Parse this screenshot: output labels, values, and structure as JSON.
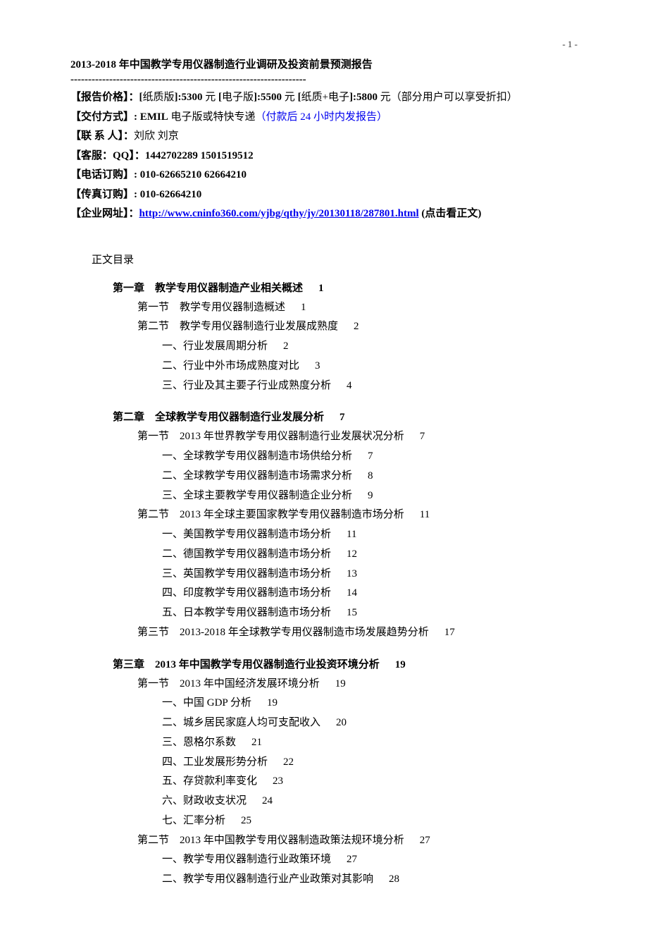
{
  "pageNumber": "- 1 -",
  "title": "2013-2018 年中国教学专用仪器制造行业调研及投资前景预测报告",
  "separator": "-------------------------------------------------------------------",
  "info": {
    "price_label": "【报告价格】：[",
    "price_paper_label": "纸质版",
    "price_paper": "]:5300",
    "price_yuan": " 元 ",
    "price_e_label_open": "[",
    "price_e_label": "电子版",
    "price_e": "]:5500",
    "price_pe_open": "[",
    "price_pe_label": "纸质+电子",
    "price_pe": "]:5800",
    "price_suffix": " 元（部分用户可以享受折扣）",
    "delivery_label": "【交付方式】: EMIL",
    "delivery_text": " 电子版或特快专递",
    "delivery_blue": "（付款后 24 小时内发报告）",
    "contact_label": "【联 系 人】：",
    "contact_names": "刘欣 刘京",
    "qq_label": "【客服：QQ】：1442702289 1501519512",
    "phone_label": "【电话订购】: 010-62665210 62664210",
    "fax_label": "【传真订购】: 010-62664210",
    "url_label": "【企业网址】：",
    "url": "http://www.cninfo360.com/yjbg/qthy/jy/20130118/287801.html",
    "url_suffix": " (点击看正文)"
  },
  "tocHeader": "正文目录",
  "toc": [
    {
      "type": "chapter",
      "text": "第一章　教学专用仪器制造产业相关概述",
      "page": "1"
    },
    {
      "type": "section",
      "text": "第一节　教学专用仪器制造概述",
      "page": "1"
    },
    {
      "type": "section",
      "text": "第二节　教学专用仪器制造行业发展成熟度",
      "page": "2"
    },
    {
      "type": "item",
      "text": "一、行业发展周期分析",
      "page": "2"
    },
    {
      "type": "item",
      "text": "二、行业中外市场成熟度对比",
      "page": "3"
    },
    {
      "type": "item",
      "text": "三、行业及其主要子行业成熟度分析",
      "page": "4"
    },
    {
      "type": "chapter",
      "text": "第二章　全球教学专用仪器制造行业发展分析",
      "page": "7"
    },
    {
      "type": "section",
      "text": "第一节　2013 年世界教学专用仪器制造行业发展状况分析",
      "page": "7"
    },
    {
      "type": "item",
      "text": "一、全球教学专用仪器制造市场供给分析",
      "page": "7"
    },
    {
      "type": "item",
      "text": "二、全球教学专用仪器制造市场需求分析",
      "page": "8"
    },
    {
      "type": "item",
      "text": "三、全球主要教学专用仪器制造企业分析",
      "page": "9"
    },
    {
      "type": "section",
      "text": "第二节　2013 年全球主要国家教学专用仪器制造市场分析",
      "page": "11"
    },
    {
      "type": "item",
      "text": "一、美国教学专用仪器制造市场分析",
      "page": "11"
    },
    {
      "type": "item",
      "text": "二、德国教学专用仪器制造市场分析",
      "page": "12"
    },
    {
      "type": "item",
      "text": "三、英国教学专用仪器制造市场分析",
      "page": "13"
    },
    {
      "type": "item",
      "text": "四、印度教学专用仪器制造市场分析",
      "page": "14"
    },
    {
      "type": "item",
      "text": "五、日本教学专用仪器制造市场分析",
      "page": "15"
    },
    {
      "type": "section",
      "text": "第三节　2013-2018 年全球教学专用仪器制造市场发展趋势分析",
      "page": "17"
    },
    {
      "type": "chapter",
      "text": "第三章　2013 年中国教学专用仪器制造行业投资环境分析",
      "page": "19"
    },
    {
      "type": "section",
      "text": "第一节　2013 年中国经济发展环境分析",
      "page": "19"
    },
    {
      "type": "item",
      "text": "一、中国 GDP 分析",
      "page": "19"
    },
    {
      "type": "item",
      "text": "二、城乡居民家庭人均可支配收入",
      "page": "20"
    },
    {
      "type": "item",
      "text": "三、恩格尔系数",
      "page": "21"
    },
    {
      "type": "item",
      "text": "四、工业发展形势分析",
      "page": "22"
    },
    {
      "type": "item",
      "text": "五、存贷款利率变化",
      "page": "23"
    },
    {
      "type": "item",
      "text": "六、财政收支状况",
      "page": "24"
    },
    {
      "type": "item",
      "text": "七、汇率分析",
      "page": "25"
    },
    {
      "type": "section",
      "text": "第二节　2013 年中国教学专用仪器制造政策法规环境分析",
      "page": "27"
    },
    {
      "type": "item",
      "text": "一、教学专用仪器制造行业政策环境",
      "page": "27"
    },
    {
      "type": "item",
      "text": "二、教学专用仪器制造行业产业政策对其影响",
      "page": "28"
    }
  ]
}
